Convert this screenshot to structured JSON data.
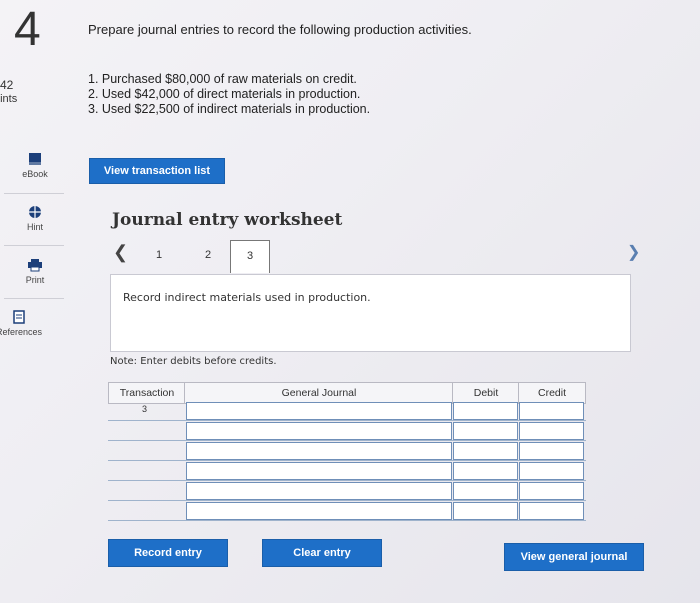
{
  "question": {
    "number": "4",
    "points_value": "42",
    "points_label": "oints"
  },
  "sidebar": {
    "items": [
      {
        "label": "eBook",
        "icon": "book-icon"
      },
      {
        "label": "Hint",
        "icon": "globe-icon"
      },
      {
        "label": "Print",
        "icon": "printer-icon"
      },
      {
        "label": "References",
        "icon": "document-icon"
      }
    ]
  },
  "prompt": "Prepare journal entries to record the following production activities.",
  "tasks": [
    "1. Purchased $80,000 of raw materials on credit.",
    "2. Used $42,000 of direct materials in production.",
    "3. Used $22,500 of indirect materials in production."
  ],
  "buttons": {
    "view_transaction_list": "View transaction list",
    "record_entry": "Record entry",
    "clear_entry": "Clear entry",
    "view_general_journal": "View general journal"
  },
  "worksheet": {
    "title": "Journal entry worksheet",
    "steps": [
      "1",
      "2",
      "3"
    ],
    "active_step": "3",
    "instruction": "Record indirect materials used in production.",
    "note": "Note: Enter debits before credits.",
    "columns": [
      "Transaction",
      "General Journal",
      "Debit",
      "Credit"
    ],
    "rows": [
      {
        "transaction": "3",
        "general_journal": "",
        "debit": "",
        "credit": ""
      },
      {
        "transaction": "",
        "general_journal": "",
        "debit": "",
        "credit": ""
      },
      {
        "transaction": "",
        "general_journal": "",
        "debit": "",
        "credit": ""
      },
      {
        "transaction": "",
        "general_journal": "",
        "debit": "",
        "credit": ""
      },
      {
        "transaction": "",
        "general_journal": "",
        "debit": "",
        "credit": ""
      },
      {
        "transaction": "",
        "general_journal": "",
        "debit": "",
        "credit": ""
      }
    ]
  },
  "colors": {
    "primary_button": "#1e6fc8",
    "cell_border": "#6f8fb8"
  }
}
